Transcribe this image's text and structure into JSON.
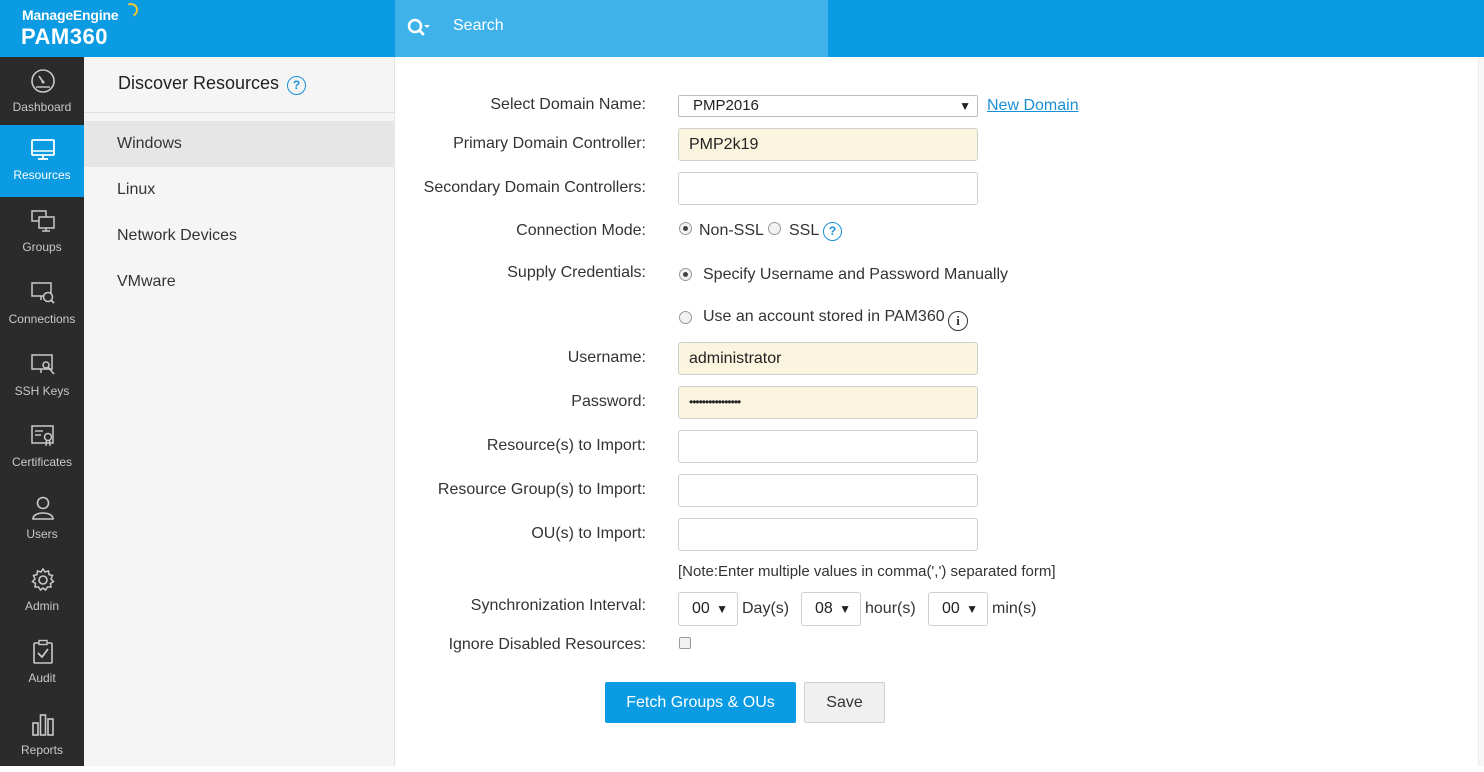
{
  "header": {
    "brand": "ManageEngine",
    "product": "PAM360",
    "search_label": "Search",
    "icons": {
      "search": "search-icon"
    }
  },
  "nav": {
    "items": [
      {
        "label": "Dashboard",
        "icon": "dashboard-gauge-icon",
        "active": false
      },
      {
        "label": "Resources",
        "icon": "monitor-icon",
        "active": true
      },
      {
        "label": "Groups",
        "icon": "grouped-monitors-icon",
        "active": false
      },
      {
        "label": "Connections",
        "icon": "remote-connection-icon",
        "active": false
      },
      {
        "label": "SSH Keys",
        "icon": "ssh-key-icon",
        "active": false
      },
      {
        "label": "Certificates",
        "icon": "certificate-icon",
        "active": false
      },
      {
        "label": "Users",
        "icon": "user-icon",
        "active": false
      },
      {
        "label": "Admin",
        "icon": "gear-icon",
        "active": false
      },
      {
        "label": "Audit",
        "icon": "clipboard-check-icon",
        "active": false
      },
      {
        "label": "Reports",
        "icon": "bar-chart-icon",
        "active": false
      }
    ]
  },
  "subpanel": {
    "title": "Discover Resources",
    "help": "?",
    "items": [
      {
        "label": "Windows",
        "active": true
      },
      {
        "label": "Linux",
        "active": false
      },
      {
        "label": "Network Devices",
        "active": false
      },
      {
        "label": "VMware",
        "active": false
      }
    ]
  },
  "form": {
    "domain_label": "Select Domain Name:",
    "domain_value": "PMP2016",
    "new_domain_link": "New Domain",
    "primary_dc_label": "Primary Domain Controller:",
    "primary_dc_value": "PMP2k19",
    "secondary_dc_label": "Secondary Domain Controllers:",
    "secondary_dc_value": "",
    "connection_mode_label": "Connection Mode:",
    "connection_mode_options": [
      "Non-SSL",
      "SSL"
    ],
    "connection_mode_selected": "Non-SSL",
    "connection_help": "?",
    "supply_credentials_label": "Supply Credentials:",
    "credential_option_manual": "Specify Username and Password Manually",
    "credential_option_stored": "Use an account stored in PAM360",
    "credential_selected": "manual",
    "info_glyph": "i",
    "username_label": "Username:",
    "username_value": "administrator",
    "password_label": "Password:",
    "password_value": "••••••••••••••••",
    "resources_label": "Resource(s) to Import:",
    "resources_value": "",
    "resource_groups_label": "Resource Group(s) to Import:",
    "resource_groups_value": "",
    "ous_label": "OU(s) to Import:",
    "ous_value": "",
    "note": "[Note:Enter multiple values in comma(',') separated form]",
    "sync_label": "Synchronization Interval:",
    "sync_days": "00",
    "sync_days_unit": "Day(s)",
    "sync_hours": "08",
    "sync_hours_unit": "hour(s)",
    "sync_mins": "00",
    "sync_mins_unit": "min(s)",
    "ignore_disabled_label": "Ignore Disabled Resources:",
    "ignore_disabled_checked": false,
    "dropdown_arrow": "▼",
    "fetch_button": "Fetch Groups & OUs",
    "save_button": "Save"
  },
  "colors": {
    "primary": "#0a9be3",
    "search_bar": "#3fb2ea",
    "nav_bg": "#2b2b2b",
    "filled_input": "#fbf5e0",
    "link": "#1a8fd6"
  }
}
